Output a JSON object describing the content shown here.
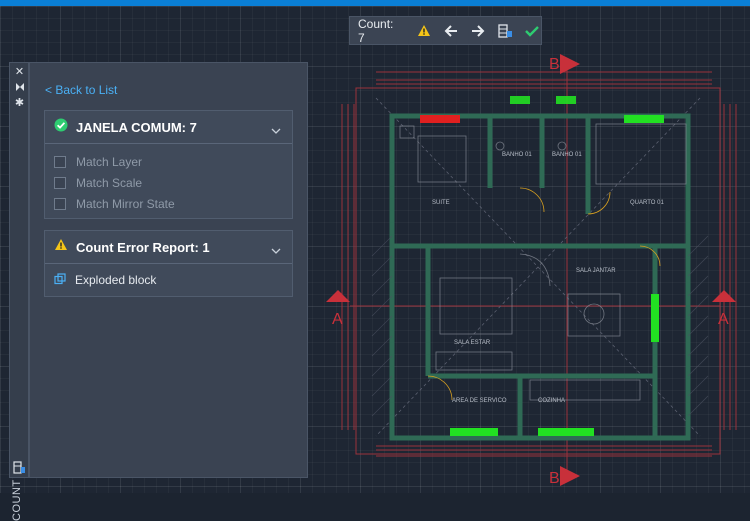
{
  "toolbar": {
    "count_label": "Count:",
    "count_value": "7",
    "icons": [
      "warning-icon",
      "arrow-left-icon",
      "arrow-right-icon",
      "insert-count-table-icon",
      "check-icon"
    ]
  },
  "palette": {
    "title": "COUNT",
    "back_link": "< Back to List",
    "block_group": {
      "title": "JANELA COMUM: 7",
      "options": [
        "Match Layer",
        "Match Scale",
        "Match Mirror State"
      ]
    },
    "error_group": {
      "title": "Count Error Report: 1",
      "items": [
        "Exploded block"
      ]
    }
  },
  "drawing": {
    "rooms": [
      "SUITE",
      "BANHO 01",
      "BANHO 01",
      "QUARTO 01",
      "SALA JANTAR",
      "SALA ESTAR",
      "AREA DE SERVICO",
      "COZINHA"
    ],
    "section_labels": [
      "B",
      "B",
      "A",
      "A"
    ]
  },
  "colors": {
    "accent_blue": "#0a7fd6",
    "highlight_green": "#22e022",
    "error_red": "#e02020",
    "wall_green": "#2f5a4a",
    "dimension_red": "#c0303a"
  }
}
